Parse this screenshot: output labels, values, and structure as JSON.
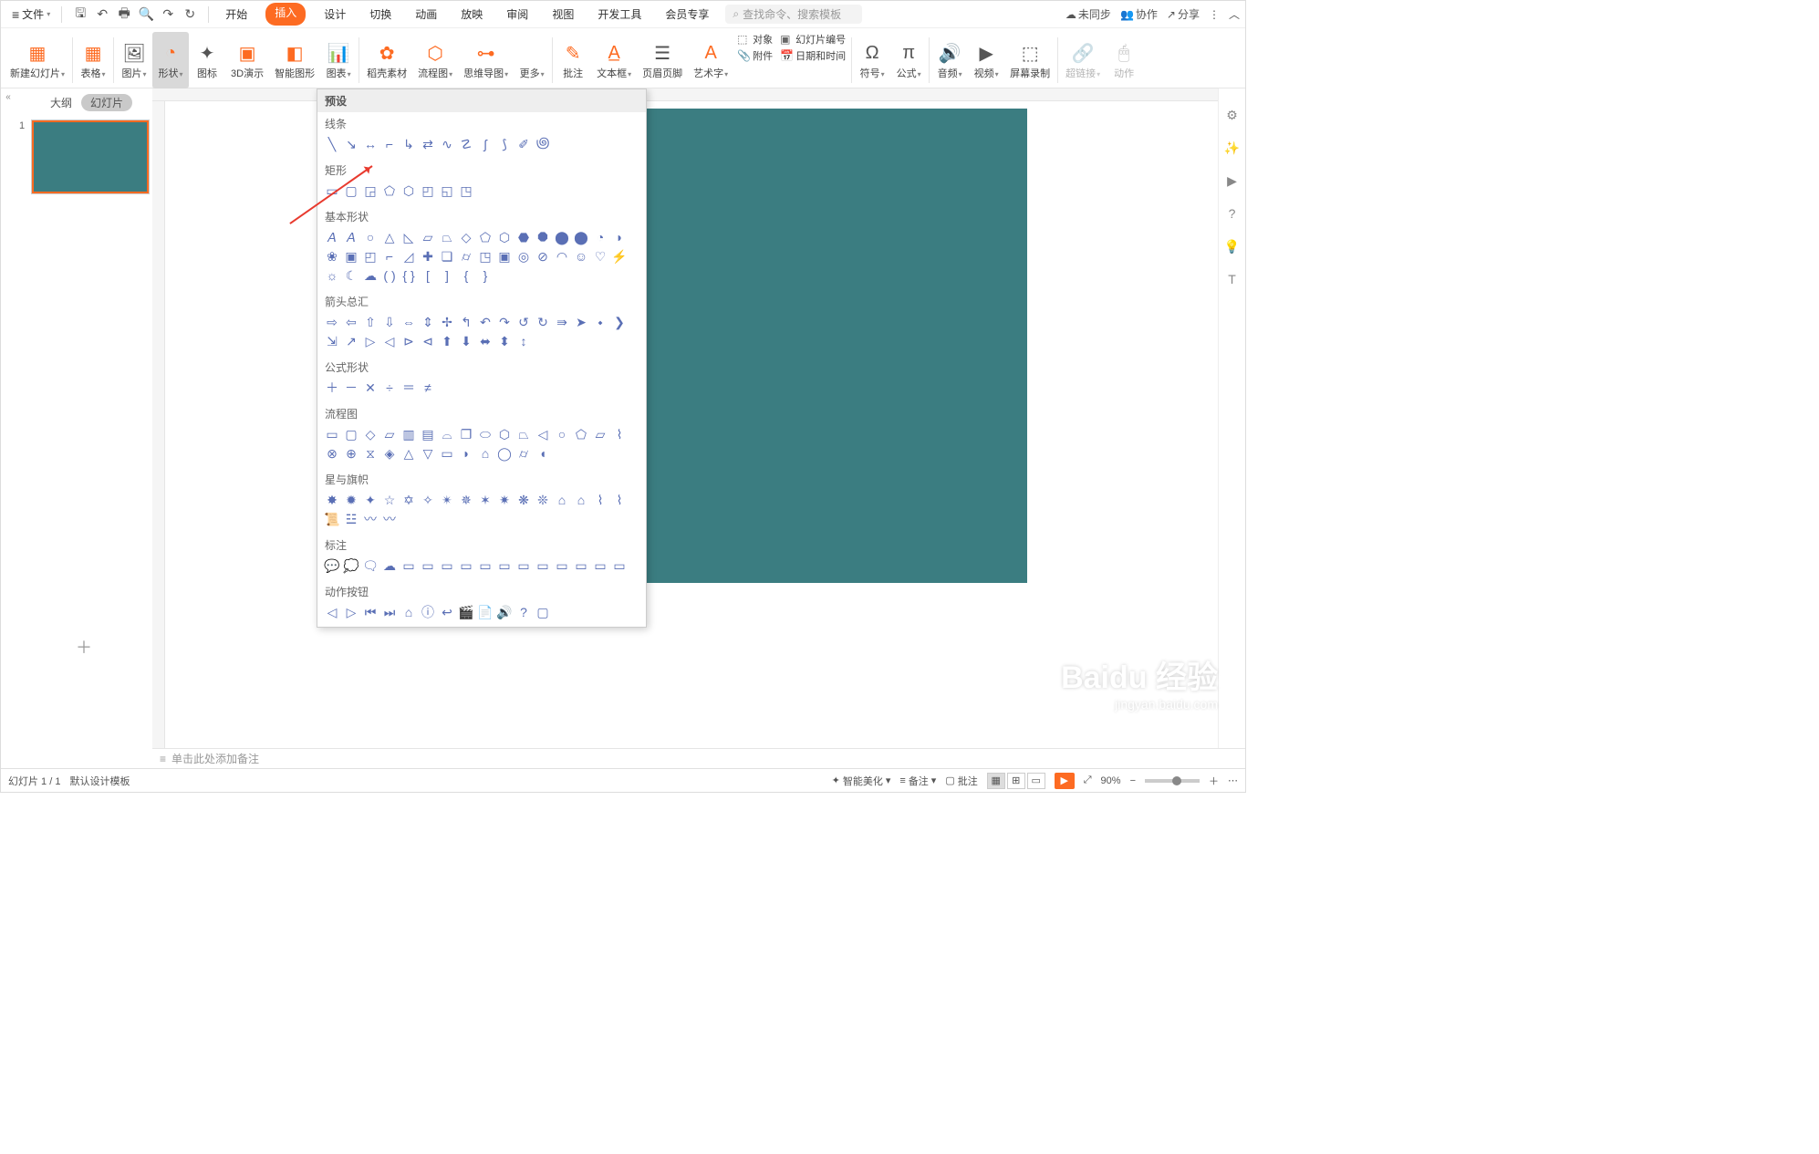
{
  "menu": {
    "file": "文件"
  },
  "tabs": {
    "start": "开始",
    "insert": "插入",
    "design": "设计",
    "transition": "切换",
    "animation": "动画",
    "slideshow": "放映",
    "review": "审阅",
    "view": "视图",
    "devtools": "开发工具",
    "member": "会员专享"
  },
  "search": {
    "placeholder": "查找命令、搜索模板"
  },
  "top_right": {
    "unsync": "未同步",
    "collab": "协作",
    "share": "分享"
  },
  "ribbon": {
    "new_slide": "新建幻灯片",
    "table": "表格",
    "picture": "图片",
    "shape": "形状",
    "icon": "图标",
    "threeD": "3D演示",
    "smart": "智能图形",
    "chart": "图表",
    "material": "稻壳素材",
    "flowchart": "流程图",
    "mindmap": "思维导图",
    "more": "更多",
    "comments": "批注",
    "textbox": "文本框",
    "header": "页眉页脚",
    "wordart": "艺术字",
    "object": "对象",
    "slidenum": "幻灯片编号",
    "attach": "附件",
    "datetime": "日期和时间",
    "symbol": "符号",
    "formula": "公式",
    "audio": "音频",
    "video": "视频",
    "record": "屏幕录制",
    "hyperlink": "超链接",
    "action": "动作"
  },
  "slides_panel": {
    "outline": "大纲",
    "slides": "幻灯片",
    "num": "1"
  },
  "shapes_dropdown": {
    "title": "预设",
    "cats": [
      "线条",
      "矩形",
      "基本形状",
      "箭头总汇",
      "公式形状",
      "流程图",
      "星与旗帜",
      "标注",
      "动作按钮"
    ]
  },
  "notes": {
    "placeholder": "单击此处添加备注"
  },
  "status": {
    "slide_count": "幻灯片 1 / 1",
    "template": "默认设计模板",
    "beautify": "智能美化",
    "notes": "备注",
    "comments": "批注",
    "zoom": "90%"
  },
  "watermark": {
    "brand": "Baidu 经验",
    "url": "jingyan.baidu.com"
  }
}
